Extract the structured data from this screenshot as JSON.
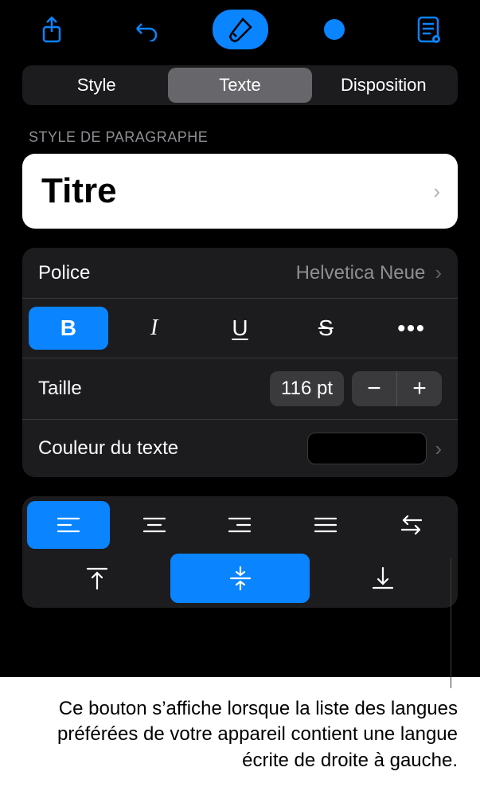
{
  "toolbar": {
    "share_name": "share-icon",
    "undo_name": "undo-icon",
    "format_name": "format-brush-icon",
    "more_name": "more-icon",
    "doc_name": "document-icon"
  },
  "tabs": {
    "style": "Style",
    "text": "Texte",
    "layout": "Disposition",
    "active": "text"
  },
  "paragraph": {
    "header": "Style de paragraphe",
    "title": "Titre"
  },
  "font": {
    "label": "Police",
    "value": "Helvetica Neue"
  },
  "format_buttons": {
    "bold": "B",
    "italic": "I",
    "underline": "U",
    "strike": "S",
    "more": "•••",
    "bold_active": true
  },
  "size": {
    "label": "Taille",
    "value": "116 pt"
  },
  "color": {
    "label": "Couleur du texte",
    "value": "#000000"
  },
  "caption": "Ce bouton s’affiche lorsque la liste des langues préférées de votre appareil contient une langue écrite de droite à gauche."
}
